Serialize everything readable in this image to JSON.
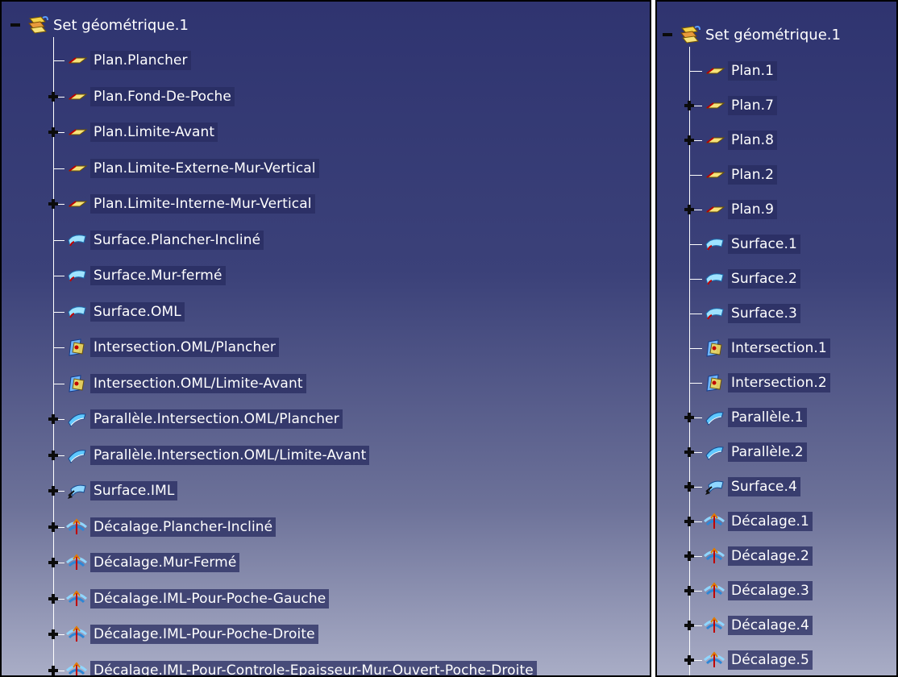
{
  "left_tree": {
    "root": {
      "label": "Set géométrique.1"
    },
    "items": [
      {
        "label": "Plan.Plancher",
        "icon": "plane-icon",
        "expander": "none"
      },
      {
        "label": "Plan.Fond-De-Poche",
        "icon": "plane-icon",
        "expander": "plus"
      },
      {
        "label": "Plan.Limite-Avant",
        "icon": "plane-icon",
        "expander": "plus"
      },
      {
        "label": "Plan.Limite-Externe-Mur-Vertical",
        "icon": "plane-icon",
        "expander": "none"
      },
      {
        "label": "Plan.Limite-Interne-Mur-Vertical",
        "icon": "plane-icon",
        "expander": "plus"
      },
      {
        "label": "Surface.Plancher-Incliné",
        "icon": "surface-icon",
        "expander": "none"
      },
      {
        "label": "Surface.Mur-fermé",
        "icon": "surface-icon",
        "expander": "none"
      },
      {
        "label": "Surface.OML",
        "icon": "surface-icon",
        "expander": "none"
      },
      {
        "label": "Intersection.OML/Plancher",
        "icon": "intersection-icon",
        "expander": "none"
      },
      {
        "label": "Intersection.OML/Limite-Avant",
        "icon": "intersection-icon",
        "expander": "none"
      },
      {
        "label": "Parallèle.Intersection.OML/Plancher",
        "icon": "parallel-curve-icon",
        "expander": "plus"
      },
      {
        "label": "Parallèle.Intersection.OML/Limite-Avant",
        "icon": "parallel-curve-icon",
        "expander": "plus"
      },
      {
        "label": "Surface.IML",
        "icon": "surface-iml-icon",
        "expander": "plus"
      },
      {
        "label": "Décalage.Plancher-Incliné",
        "icon": "offset-icon",
        "expander": "plus"
      },
      {
        "label": "Décalage.Mur-Fermé",
        "icon": "offset-icon",
        "expander": "plus"
      },
      {
        "label": "Décalage.IML-Pour-Poche-Gauche",
        "icon": "offset-icon",
        "expander": "plus"
      },
      {
        "label": "Décalage.IML-Pour-Poche-Droite",
        "icon": "offset-icon",
        "expander": "plus"
      },
      {
        "label": "Décalage.IML-Pour-Controle-Epaisseur-Mur-Ouvert-Poche-Droite",
        "icon": "offset-icon",
        "expander": "plus"
      }
    ]
  },
  "right_tree": {
    "root": {
      "label": "Set géométrique.1"
    },
    "items": [
      {
        "label": "Plan.1",
        "icon": "plane-icon",
        "expander": "none"
      },
      {
        "label": "Plan.7",
        "icon": "plane-icon",
        "expander": "plus"
      },
      {
        "label": "Plan.8",
        "icon": "plane-icon",
        "expander": "plus"
      },
      {
        "label": "Plan.2",
        "icon": "plane-icon",
        "expander": "none"
      },
      {
        "label": "Plan.9",
        "icon": "plane-icon",
        "expander": "plus"
      },
      {
        "label": "Surface.1",
        "icon": "surface-icon",
        "expander": "none"
      },
      {
        "label": "Surface.2",
        "icon": "surface-icon",
        "expander": "none"
      },
      {
        "label": "Surface.3",
        "icon": "surface-icon",
        "expander": "none"
      },
      {
        "label": "Intersection.1",
        "icon": "intersection-icon",
        "expander": "none"
      },
      {
        "label": "Intersection.2",
        "icon": "intersection-icon",
        "expander": "none"
      },
      {
        "label": "Parallèle.1",
        "icon": "parallel-curve-icon",
        "expander": "plus"
      },
      {
        "label": "Parallèle.2",
        "icon": "parallel-curve-icon",
        "expander": "plus"
      },
      {
        "label": "Surface.4",
        "icon": "surface-iml-icon",
        "expander": "plus"
      },
      {
        "label": "Décalage.1",
        "icon": "offset-icon",
        "expander": "plus"
      },
      {
        "label": "Décalage.2",
        "icon": "offset-icon",
        "expander": "plus"
      },
      {
        "label": "Décalage.3",
        "icon": "offset-icon",
        "expander": "plus"
      },
      {
        "label": "Décalage.4",
        "icon": "offset-icon",
        "expander": "plus"
      },
      {
        "label": "Décalage.5",
        "icon": "offset-icon",
        "expander": "plus"
      }
    ]
  },
  "colors": {
    "panel_top": "#2f3470",
    "panel_bottom": "#a9adc6",
    "label_highlight": "#282c60",
    "text": "#ffffff"
  }
}
